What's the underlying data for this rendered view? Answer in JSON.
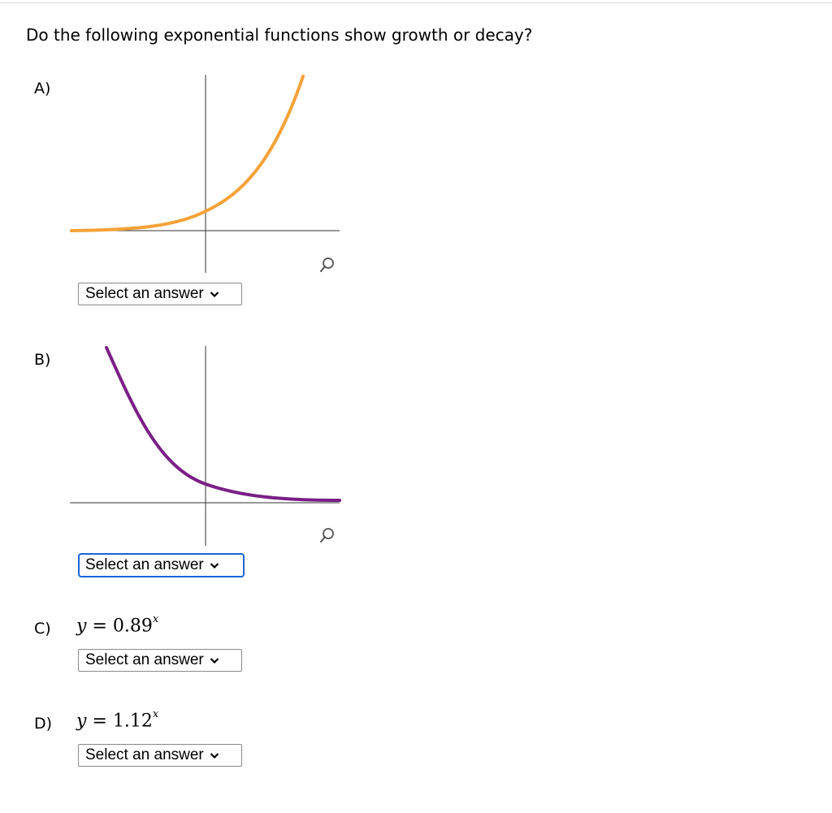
{
  "question": "Do the following exponential functions show growth or decay?",
  "parts": [
    {
      "label": "A)",
      "graph": {
        "curve": "growth",
        "curve_color": "#f5a238",
        "zoom_icon": "magnify-icon"
      },
      "select": {
        "value": "Select an answer"
      }
    },
    {
      "label": "B)",
      "graph": {
        "curve": "decay",
        "curve_color": "#7a1f86",
        "zoom_icon": "magnify-icon"
      },
      "select": {
        "value": "Select an answer",
        "focused": true
      }
    },
    {
      "label": "C)",
      "formula": {
        "lhs": "y",
        "eq": "=",
        "base": "0.89",
        "exponent": "x"
      },
      "select": {
        "value": "Select an answer"
      }
    },
    {
      "label": "D)",
      "formula": {
        "lhs": "y",
        "eq": "=",
        "base": "1.12",
        "exponent": "x"
      },
      "select": {
        "value": "Select an answer"
      }
    }
  ],
  "colors": {
    "axis": "#333333",
    "focus": "#1a65d8"
  },
  "icons": {
    "dropdown": "chevron-down-icon",
    "zoom": "magnify-icon"
  }
}
